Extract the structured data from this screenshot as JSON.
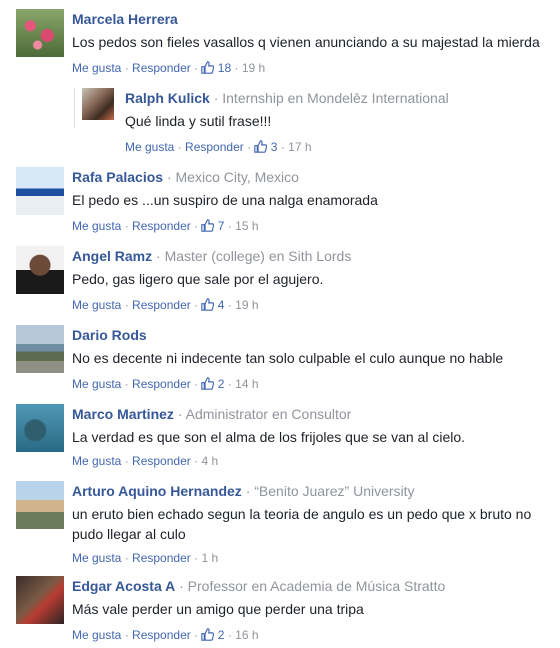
{
  "actions": {
    "like": "Me gusta",
    "reply": "Responder",
    "sep": "·"
  },
  "comments": [
    {
      "name": "Marcela Herrera",
      "role": "",
      "text": "Los pedos son fieles vasallos q vienen anunciando a su majestad la mierda",
      "likes": "18",
      "time": "19 h",
      "avatar_icon": "profile-photo-flowers"
    },
    {
      "name": "Ralph Kulick",
      "role": "Internship en Mondelēz International",
      "text": "Qué linda y sutil frase!!!",
      "likes": "3",
      "time": "17 h",
      "avatar_icon": "profile-photo-ralph"
    },
    {
      "name": "Rafa Palacios",
      "role": "Mexico City, Mexico",
      "text": "El pedo es ...un suspiro de una nalga enamorada",
      "likes": "7",
      "time": "15 h",
      "avatar_icon": "profile-photo-rafa"
    },
    {
      "name": "Angel Ramz",
      "role": "Master (college) en Sith Lords",
      "text": "Pedo, gas ligero que sale por el agujero.",
      "likes": "4",
      "time": "19 h",
      "avatar_icon": "profile-photo-angel"
    },
    {
      "name": "Dario Rods",
      "role": "",
      "text": "No es decente ni indecente tan solo culpable el culo aunque no hable",
      "likes": "2",
      "time": "14 h",
      "avatar_icon": "profile-photo-dario"
    },
    {
      "name": "Marco Martinez",
      "role": "Administrator en Consultor",
      "text": "La verdad es que son el alma de los frijoles que se van al cielo.",
      "likes": "",
      "time": "4 h",
      "avatar_icon": "profile-photo-marco"
    },
    {
      "name": "Arturo Aquino Hernandez",
      "role": "“Benito Juarez” University",
      "text": "un eruto bien echado segun la teoria de angulo es un pedo que x bruto no pudo llegar al culo",
      "likes": "",
      "time": "1 h",
      "avatar_icon": "profile-photo-arturo"
    },
    {
      "name": "Edgar Acosta A",
      "role": "Professor en Academia de Música Stratto",
      "text": "Más vale perder un amigo que perder una tripa",
      "likes": "2",
      "time": "16 h",
      "avatar_icon": "profile-photo-edgar"
    }
  ]
}
